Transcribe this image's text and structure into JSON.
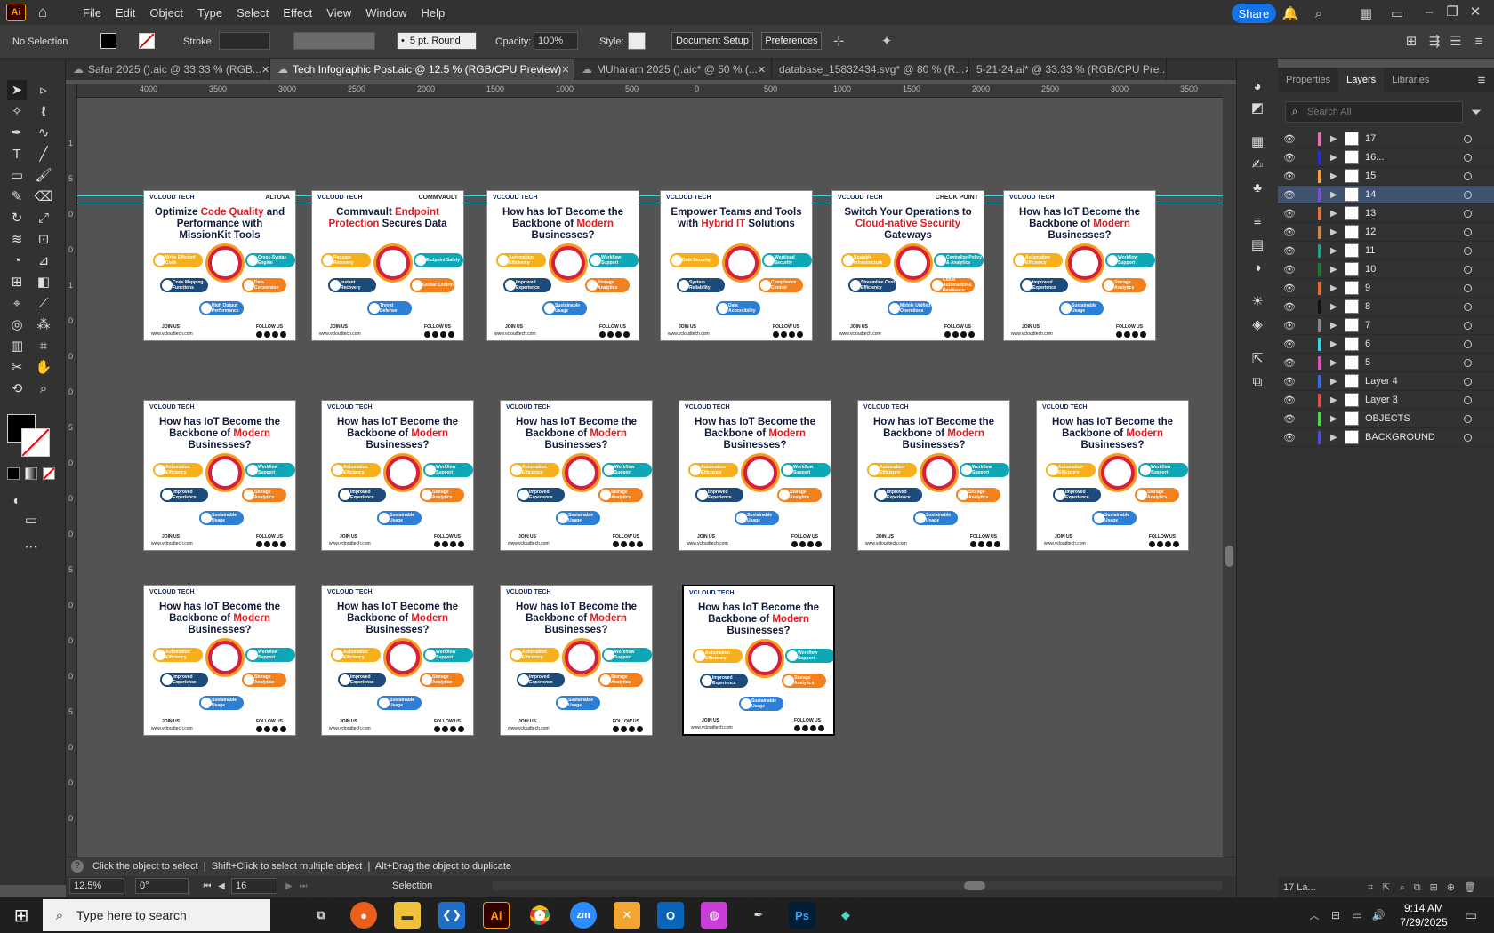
{
  "menubar": {
    "logo": "Ai",
    "items": [
      "File",
      "Edit",
      "Object",
      "Type",
      "Select",
      "Effect",
      "View",
      "Window",
      "Help"
    ],
    "share": "Share"
  },
  "control": {
    "selection": "No Selection",
    "stroke_label": "Stroke:",
    "brush": "5 pt. Round",
    "opacity_label": "Opacity:",
    "opacity": "100%",
    "style_label": "Style:",
    "doc_setup": "Document Setup",
    "preferences": "Preferences"
  },
  "tabs": [
    "Safar 2025 ().aic @ 33.33 % (RGB...",
    "Tech Infographic Post.aic @ 12.5 % (RGB/CPU Preview)",
    "MUharam 2025 ().aic* @ 50 % (...",
    "database_15832434.svg* @ 80 % (R...",
    "5-21-24.ai* @ 33.33 % (RGB/CPU Pre..."
  ],
  "ruler_top": [
    "4000",
    "3500",
    "3000",
    "2500",
    "2000",
    "1500",
    "1000",
    "500",
    "0",
    "500",
    "1000",
    "1500",
    "2000",
    "2500",
    "3000",
    "3500"
  ],
  "ruler_left": [
    "1",
    "5",
    "0",
    "0",
    "1",
    "0",
    "0",
    "0",
    "5",
    "0",
    "0",
    "0",
    "5",
    "0",
    "0",
    "0",
    "5",
    "0",
    "0",
    "0"
  ],
  "artboard": {
    "brand": "VCLOUD TECH",
    "join": "JOIN US",
    "follow": "FOLLOW US",
    "site": "www.vcloudtech.com"
  },
  "artboards": [
    {
      "partner": "ALTOVA",
      "h1": "Optimize ",
      "em": "Code Quality",
      "h2": " and Performance with MissionKit Tools",
      "pills": [
        "Write Efficient Code",
        "Cross-Syntax Engine",
        "Code Mapping Functions",
        "Data Conversion",
        "High Output Performance"
      ]
    },
    {
      "partner": "COMMVAULT",
      "h1": "Commvault ",
      "em": "Endpoint Protection",
      "h2": " Secures Data",
      "pills": [
        "Ransom Recovery",
        "Endpoint Safety",
        "Instant Recovery",
        "Global Control",
        "Threat Defense"
      ]
    },
    {
      "partner": "",
      "h1": "How has IoT Become the Backbone of ",
      "em": "Modern",
      "h2": " Businesses?",
      "pills": [
        "Automation Efficiency",
        "Workflow Support",
        "Improved Experience",
        "Storage Analytics",
        "Sustainable Usage"
      ]
    },
    {
      "partner": "",
      "h1": "Empower Teams and Tools with ",
      "em": "Hybrid IT",
      "h2": " Solutions",
      "pills": [
        "Data Security",
        "Workload Security",
        "System Reliability",
        "Compliance Control",
        "Data Accessibility"
      ]
    },
    {
      "partner": "CHECK POINT",
      "h1": "Switch Your Operations to ",
      "em": "Cloud-native Security",
      "h2": " Gateways",
      "pills": [
        "Scalable Infrastructure",
        "Centralize Policy & Analytics",
        "Streamline Cost Efficiency",
        "Cloud Automation & Resilience",
        "Mobile Unified Operations"
      ]
    },
    {
      "partner": "",
      "h1": "How has IoT Become the Backbone of ",
      "em": "Modern",
      "h2": " Businesses?",
      "pills": [
        "Automation Efficiency",
        "Workflow Support",
        "Improved Experience",
        "Storage Analytics",
        "Sustainable Usage"
      ]
    },
    {
      "partner": "",
      "h1": "How has IoT Become the Backbone of ",
      "em": "Modern",
      "h2": " Businesses?",
      "pills": [
        "Automation Efficiency",
        "Workflow Support",
        "Improved Experience",
        "Storage Analytics",
        "Sustainable Usage"
      ]
    },
    {
      "partner": "",
      "h1": "How has IoT Become the Backbone of ",
      "em": "Modern",
      "h2": " Businesses?",
      "pills": [
        "Automation Efficiency",
        "Workflow Support",
        "Improved Experience",
        "Storage Analytics",
        "Sustainable Usage"
      ]
    },
    {
      "partner": "",
      "h1": "How has IoT Become the Backbone of ",
      "em": "Modern",
      "h2": " Businesses?",
      "pills": [
        "Automation Efficiency",
        "Workflow Support",
        "Improved Experience",
        "Storage Analytics",
        "Sustainable Usage"
      ]
    },
    {
      "partner": "",
      "h1": "How has IoT Become the Backbone of ",
      "em": "Modern",
      "h2": " Businesses?",
      "pills": [
        "Automation Efficiency",
        "Workflow Support",
        "Improved Experience",
        "Storage Analytics",
        "Sustainable Usage"
      ]
    },
    {
      "partner": "",
      "h1": "How has IoT Become the Backbone of ",
      "em": "Modern",
      "h2": " Businesses?",
      "pills": [
        "Automation Efficiency",
        "Workflow Support",
        "Improved Experience",
        "Storage Analytics",
        "Sustainable Usage"
      ]
    },
    {
      "partner": "",
      "h1": "How has IoT Become the Backbone of ",
      "em": "Modern",
      "h2": " Businesses?",
      "pills": [
        "Automation Efficiency",
        "Workflow Support",
        "Improved Experience",
        "Storage Analytics",
        "Sustainable Usage"
      ]
    },
    {
      "partner": "",
      "h1": "How has IoT Become the Backbone of ",
      "em": "Modern",
      "h2": " Businesses?",
      "pills": [
        "Automation Efficiency",
        "Workflow Support",
        "Improved Experience",
        "Storage Analytics",
        "Sustainable Usage"
      ]
    },
    {
      "partner": "",
      "h1": "How has IoT Become the Backbone of ",
      "em": "Modern",
      "h2": " Businesses?",
      "pills": [
        "Automation Efficiency",
        "Workflow Support",
        "Improved Experience",
        "Storage Analytics",
        "Sustainable Usage"
      ]
    },
    {
      "partner": "",
      "h1": "How has IoT Become the Backbone of ",
      "em": "Modern",
      "h2": " Businesses?",
      "pills": [
        "Automation Efficiency",
        "Workflow Support",
        "Improved Experience",
        "Storage Analytics",
        "Sustainable Usage"
      ]
    },
    {
      "partner": "",
      "h1": "How has IoT Become the Backbone of ",
      "em": "Modern",
      "h2": " Businesses?",
      "pills": [
        "Automation Efficiency",
        "Workflow Support",
        "Improved Experience",
        "Storage Analytics",
        "Sustainable Usage"
      ]
    }
  ],
  "status": {
    "hint": "Click the object to select  |  Shift+Click to select multiple object  |  Alt+Drag the object to duplicate",
    "zoom": "12.5%",
    "rotate": "0°",
    "artboard_num": "16",
    "tool": "Selection"
  },
  "panel": {
    "tabs": [
      "Properties",
      "Layers",
      "Libraries"
    ],
    "search_placeholder": "Search All",
    "footer": "17 La...",
    "layers": [
      {
        "name": "17",
        "color": "#e86fb5"
      },
      {
        "name": "16...",
        "color": "#2a2ad6"
      },
      {
        "name": "15",
        "color": "#f2a33a"
      },
      {
        "name": "14",
        "color": "#7b4fd6",
        "selected": true
      },
      {
        "name": "13",
        "color": "#e86f3a"
      },
      {
        "name": "12",
        "color": "#c8884f"
      },
      {
        "name": "11",
        "color": "#1aa58c"
      },
      {
        "name": "10",
        "color": "#1e7a2a"
      },
      {
        "name": "9",
        "color": "#e8692a"
      },
      {
        "name": "8",
        "color": "#111111"
      },
      {
        "name": "7",
        "color": "#888888"
      },
      {
        "name": "6",
        "color": "#3ad6e6"
      },
      {
        "name": "5",
        "color": "#e04fb8"
      },
      {
        "name": "Layer 4",
        "color": "#3a6ee0"
      },
      {
        "name": "Layer 3",
        "color": "#e04f4f"
      },
      {
        "name": "OBJECTS",
        "color": "#4fd64f"
      },
      {
        "name": "BACKGROUND",
        "color": "#4f4fd6"
      }
    ]
  },
  "taskbar": {
    "search": "Type here to search",
    "time": "9:14 AM",
    "date": "7/29/2025"
  }
}
